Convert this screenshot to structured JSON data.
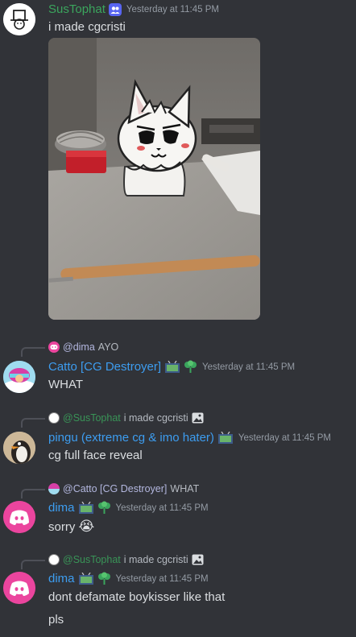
{
  "messages": [
    {
      "author": "SusTophat",
      "author_color": "#3ba55d",
      "timestamp": "Yesterday at 11:45 PM",
      "text": "i made cgcristi",
      "avatar_icon": "top-hat-icon",
      "has_image": true
    },
    {
      "reply_mention": "@dima",
      "reply_text": "AYO",
      "author": "Catto [CG Destroyer]",
      "author_color": "#3d9df0",
      "timestamp": "Yesterday at 11:45 PM",
      "text": "WHAT"
    },
    {
      "reply_mention": "@SusTophat",
      "reply_text": "i made cgcristi",
      "author": "pingu (extreme cg & imo hater)",
      "author_color": "#3d9df0",
      "timestamp": "Yesterday at 11:45 PM",
      "text": "cg full face reveal"
    },
    {
      "reply_mention": "@Catto [CG Destroyer]",
      "reply_text": "WHAT",
      "author": "dima",
      "author_color": "#3d9df0",
      "timestamp": "Yesterday at 11:45 PM",
      "text": "sorry",
      "emoji": "😭"
    },
    {
      "reply_mention": "@SusTophat",
      "reply_text": "i made cgcristi",
      "author": "dima",
      "author_color": "#3d9df0",
      "timestamp": "Yesterday at 11:45 PM",
      "text": "dont defamate boykisser like that",
      "text2": "pls"
    }
  ],
  "colors": {
    "background": "#313338",
    "discord_blurple": "#eb459e",
    "mention_green": "#3ba55d",
    "muted": "#949ba4"
  }
}
